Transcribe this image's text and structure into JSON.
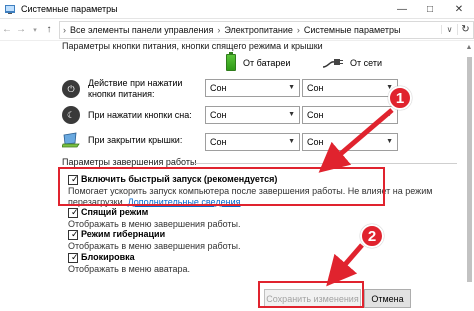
{
  "window": {
    "title": "Системные параметры"
  },
  "address": {
    "crumbs": [
      "Все элементы панели управления",
      "Электропитание",
      "Системные параметры"
    ]
  },
  "power_buttons": {
    "section_title": "Параметры кнопки питания, кнопки спящего режима и крышки",
    "col_battery": "От батареи",
    "col_ac": "От сети",
    "rows": [
      {
        "label": "Действие при нажатии кнопки питания:",
        "battery": "Сон",
        "ac": "Сон"
      },
      {
        "label": "При нажатии кнопки сна:",
        "battery": "Сон",
        "ac": "Сон"
      },
      {
        "label": "При закрытии крышки:",
        "battery": "Сон",
        "ac": "Сон"
      }
    ]
  },
  "shutdown": {
    "section_title": "Параметры завершения работы",
    "fast_startup": {
      "label": "Включить быстрый запуск (рекомендуется)",
      "desc_line1": "Помогает ускорить запуск компьютера после завершения работы. Не влияет на режим",
      "desc_line2_prefix": "перезагрузки. ",
      "link": "Дополнительные сведения"
    },
    "sleep": {
      "label": "Спящий режим",
      "desc": "Отображать в меню завершения работы."
    },
    "hibernate": {
      "label": "Режим гибернации",
      "desc": "Отображать в меню завершения работы."
    },
    "lock": {
      "label": "Блокировка",
      "desc": "Отображать в меню аватара."
    }
  },
  "footer": {
    "save_label": "Сохранить изменения",
    "cancel_label": "Отмена"
  },
  "annotations": {
    "badge1": "1",
    "badge2": "2"
  },
  "colors": {
    "highlight": "#e0232e",
    "link": "#0066cc"
  },
  "icons": [
    "control-panel-icon",
    "minimize-icon",
    "maximize-icon",
    "close-icon",
    "back-arrow-icon",
    "forward-arrow-icon",
    "recent-dropdown-icon",
    "up-arrow-icon",
    "refresh-icon",
    "battery-icon",
    "power-plug-icon",
    "power-button-icon",
    "moon-icon",
    "laptop-lid-icon",
    "checkbox-checked-icon"
  ]
}
